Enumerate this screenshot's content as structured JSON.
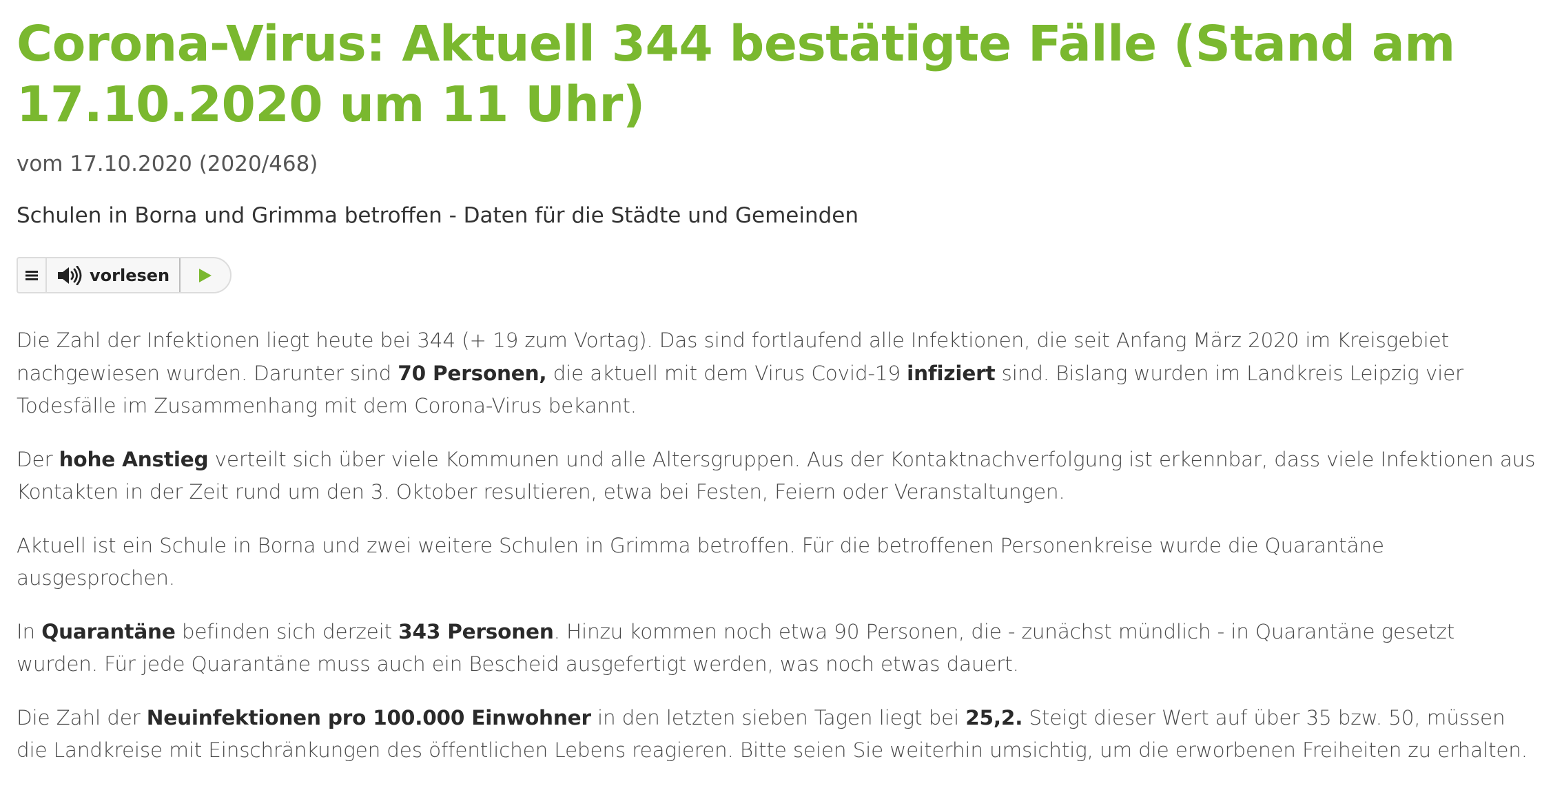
{
  "article": {
    "title": "Corona-Virus: Aktuell 344 bestätigte Fälle (Stand am 17.10.2020 um 11 Uhr)",
    "meta": "vom 17.10.2020 (2020/468)",
    "subtitle": "Schulen in Borna und Grimma betroffen - Daten für die Städte und Gemeinden"
  },
  "readspeaker": {
    "menu_icon": "menu-icon",
    "speaker_icon": "speaker-icon",
    "label": "vorlesen",
    "play_icon": "play-icon",
    "accent": "#7ab82f"
  },
  "paragraphs": {
    "p1": {
      "t1": "Die Zahl der Infektionen liegt heute bei 344 (+ 19 zum Vortag). Das sind fortlaufend alle Infektionen, die seit Anfang März 2020 im Kreisgebiet nachgewiesen wurden. Darunter sind ",
      "b1": "70 Personen,",
      "t2": " die aktuell mit dem Virus Covid-19 ",
      "b2": "infiziert",
      "t3": " sind. Bislang wurden im Landkreis Leipzig vier Todesfälle im Zusammenhang mit dem Corona-Virus bekannt."
    },
    "p2": {
      "t1": "Der ",
      "b1": "hohe Anstieg",
      "t2": " verteilt sich über viele Kommunen und alle Altersgruppen. Aus der Kontaktnachverfolgung ist erkennbar, dass viele Infektionen aus Kontakten in der Zeit rund um den 3. Oktober resultieren, etwa bei Festen, Feiern oder Veranstaltungen."
    },
    "p3": {
      "t1": "Aktuell ist ein Schule in Borna und zwei weitere Schulen in Grimma betroffen. Für die betroffenen Personenkreise wurde die Quarantäne ausgesprochen."
    },
    "p4": {
      "t1": "In ",
      "b1": "Quarantäne",
      "t2": " befinden sich derzeit ",
      "b2": "343 Personen",
      "t3": ". Hinzu kommen noch etwa 90 Personen, die - zunächst mündlich - in Quarantäne gesetzt wurden. Für jede Quarantäne muss  auch ein Bescheid ausgefertigt werden, was noch etwas dauert."
    },
    "p5": {
      "t1": "Die Zahl der ",
      "b1": "Neuinfektionen pro 100.000 Einwohner",
      "t2": " in den letzten sieben Tagen liegt bei ",
      "b2": "25,2.",
      "t3": " Steigt dieser Wert auf über 35 bzw. 50, müssen die Landkreise mit Einschränkungen des öffentlichen Lebens reagieren. Bitte seien Sie weiterhin umsichtig, um die erworbenen Freiheiten zu erhalten."
    }
  }
}
